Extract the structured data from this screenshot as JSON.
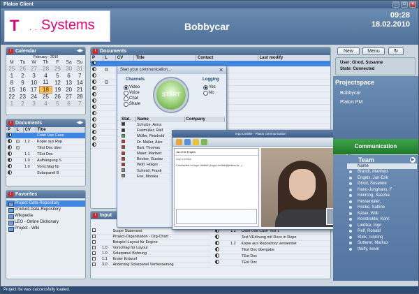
{
  "window": {
    "title": "Platon Client"
  },
  "header": {
    "logo_t": "T",
    "logo_dots": "· · ·",
    "logo_text": "Systems",
    "app_title": "Bobbycar",
    "time": "09:28",
    "date": "18.02.2010"
  },
  "calendar": {
    "title": "Calendar",
    "month": "February - 2010",
    "weekdays": [
      "M",
      "Tu",
      "W",
      "Th",
      "F",
      "Sa",
      "Su"
    ],
    "rows": [
      [
        "25",
        "26",
        "27",
        "28",
        "29",
        "30",
        "31"
      ],
      [
        "1",
        "2",
        "3",
        "4",
        "5",
        "6",
        "7"
      ],
      [
        "8",
        "9",
        "10",
        "11",
        "12",
        "13",
        "14"
      ],
      [
        "15",
        "16",
        "17",
        "18",
        "19",
        "20",
        "21"
      ],
      [
        "22",
        "23",
        "24",
        "25",
        "26",
        "27",
        "28"
      ],
      [
        "1",
        "2",
        "3",
        "4",
        "5",
        "6",
        "7"
      ]
    ],
    "selected": "18"
  },
  "docs_small": {
    "title": "Documents",
    "cols": [
      "P",
      "L",
      "CV",
      "Title"
    ],
    "rows": [
      [
        "",
        "",
        "",
        "Cebit Use Case"
      ],
      [
        "",
        "",
        "1.2",
        "Kopie aus Rep"
      ],
      [
        "",
        "",
        "",
        "TEst Doc über"
      ],
      [
        "",
        "",
        "1.1",
        "TEst Doc"
      ],
      [
        "",
        "",
        "1.0",
        "Aufhängung S"
      ],
      [
        "",
        "",
        "1.0",
        "Vorschlag für"
      ],
      [
        "",
        "",
        "",
        "Solarpanel B"
      ]
    ]
  },
  "favorites": {
    "title": "Favorites",
    "items": [
      "Project-Data-Repository",
      "Product-Data-Repository",
      "Wikipedia",
      "LEO - Online Dictionary",
      "Project - Wiki"
    ]
  },
  "documents": {
    "title": "Documents",
    "cols": [
      "P",
      "L",
      "CV",
      "Title",
      "Contact",
      "Last modify"
    ]
  },
  "comm": {
    "title": "Start your communication...",
    "channels_label": "Channels",
    "channels": [
      "Video",
      "Voice",
      "Chat",
      "Share"
    ],
    "logging_label": "Logging",
    "logging": [
      "Yes",
      "No"
    ],
    "start": "START",
    "cols": [
      "Stat.",
      "Name",
      "Company"
    ],
    "users": [
      "Schulze, Anna",
      "Freimüller, Ralf",
      "Müller, Reinhold",
      "Dr. Müller, Alex",
      "Bart, Thomas",
      "Maier, Marbert",
      "Becker, Gustav",
      "Wolf, Holger",
      "Schmid, Frank",
      "Frei, Monika"
    ]
  },
  "video": {
    "title": "Ingo Liedtke · Platon communication",
    "contact": "Jan-Erik Engels",
    "contact2": "Ingo Liedtke",
    "msg": "Connected to Ingo Liedtke (Ingo.Liedtke@platon-st...)"
  },
  "input": {
    "title": "Input",
    "rows": [
      [
        "Scope Statement",
        ""
      ],
      [
        "Project-Organisation - Org-Chart",
        ""
      ],
      [
        "Beispiel-Layout für Engine",
        ""
      ],
      [
        "1.0",
        "Vorschlag für Layout"
      ],
      [
        "1.0",
        "Solarpanel Bohrung"
      ],
      [
        "1.1",
        "Erster Entwurf"
      ],
      [
        "3.0",
        "Änderung Solarpanel Verbesserung"
      ]
    ]
  },
  "output": {
    "rows": [
      [
        "1.2",
        "Cebit Use Case Test 1"
      ],
      [
        "",
        "Test VErlinung mit Docs in Repo"
      ],
      [
        "1.2",
        "Kopie aus Repository verwendet"
      ],
      [
        "",
        "TEst Doc übergabe"
      ],
      [
        "",
        "TEst Doc"
      ],
      [
        "",
        "TEst Doc"
      ]
    ]
  },
  "right": {
    "new": "New",
    "menu": "Menu",
    "refresh": "↻",
    "user_label": "User:",
    "user": "Girod, Susanne",
    "state_label": "State:",
    "state": "Connected",
    "projectspace": "Projectspace",
    "projects": [
      "Bobbycar",
      "Platon PM"
    ],
    "communication": "Communication"
  },
  "team": {
    "title": "Team",
    "name_col": "Name",
    "members": [
      "Brandt, Manfred",
      "Engels, Jan-Erik",
      "Girod, Susanne",
      "Hano-Junghans, F",
      "Henning, Sascha",
      "Hessentaler,",
      "Hocke, Sabine",
      "Käser, Willi",
      "Konstruktiv, Konr.",
      "Liedtke, Ingo",
      "Relf, Ronald",
      "Stick, running",
      "Sutterer, Markus",
      "thülfy, kevin"
    ]
  },
  "status": "Project list was successfully loaded."
}
